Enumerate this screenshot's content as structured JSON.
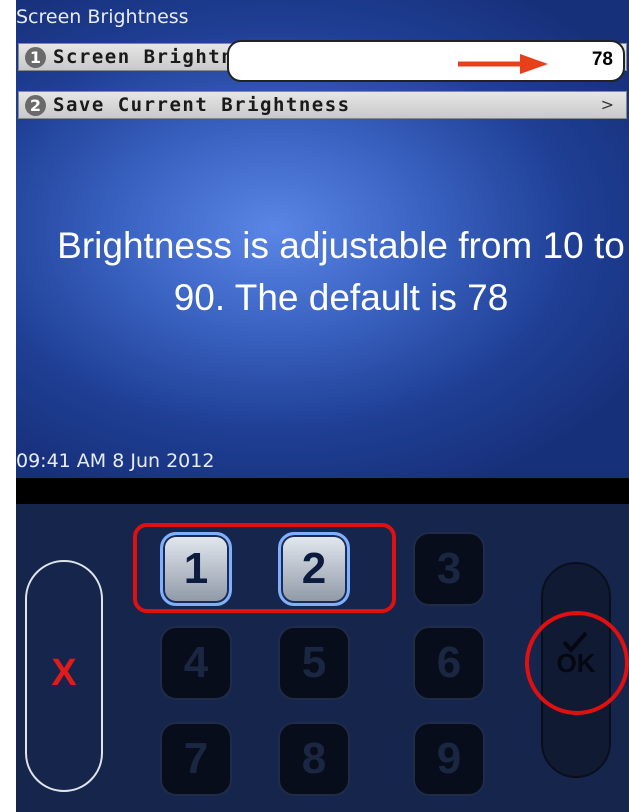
{
  "screen": {
    "title": "Screen Brightness",
    "menu": [
      {
        "number": "1",
        "label": "Screen Brightness",
        "chevron": ">"
      },
      {
        "number": "2",
        "label": "Save Current Brightness",
        "chevron": ">"
      }
    ],
    "brightness_value": "78",
    "info_text": "Brightness is adjustable from 10 to 90. The default is 78",
    "datetime": "09:41 AM 8 Jun 2012"
  },
  "keypad": {
    "keys": [
      {
        "label": "1",
        "state": "active"
      },
      {
        "label": "2",
        "state": "active"
      },
      {
        "label": "3",
        "state": "inactive"
      },
      {
        "label": "4",
        "state": "inactive"
      },
      {
        "label": "5",
        "state": "inactive"
      },
      {
        "label": "6",
        "state": "inactive"
      },
      {
        "label": "7",
        "state": "inactive"
      },
      {
        "label": "8",
        "state": "inactive"
      },
      {
        "label": "9",
        "state": "inactive"
      }
    ],
    "cancel_label": "X",
    "ok_label": "OK"
  },
  "colors": {
    "highlight": "#e01010",
    "arrow": "#e8401a",
    "screen_blue": "#3a63c2",
    "keypad_navy": "#16254c"
  },
  "icons": {
    "arrow": "right-arrow-icon",
    "check": "check-icon",
    "cancel": "x-icon"
  }
}
